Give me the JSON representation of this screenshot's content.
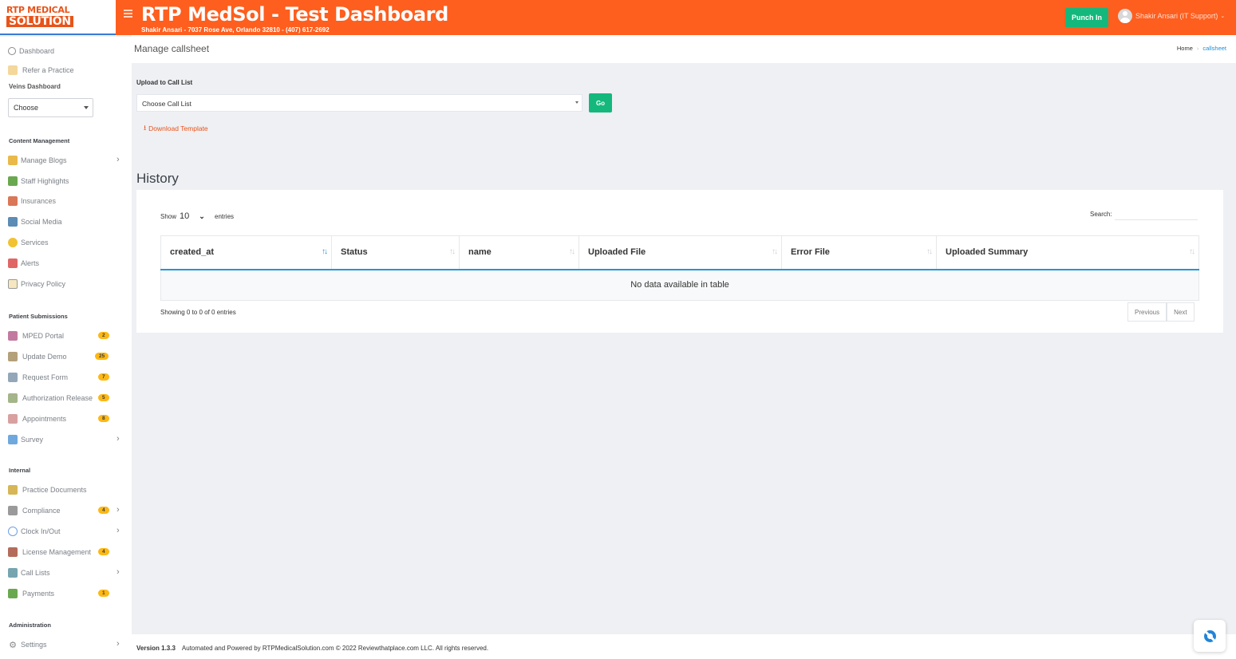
{
  "logo": {
    "line1": "RTP MEDICAL",
    "line2": "SOLUTION"
  },
  "header": {
    "title": "RTP MedSol - Test Dashboard",
    "subtitle": "Shakir Ansari - 7037 Rose Ave, Orlando 32810 - (407) 617-2692",
    "punch_label": "Punch In",
    "user_name": "Shakir Ansari (IT Support)",
    "accent": "#fe5e1e"
  },
  "sidebar": {
    "dashboard": "Dashboard",
    "refer": "Refer a Practice",
    "veins_title": "Veins Dashboard",
    "veins_select": "Choose",
    "sec_content": "Content Management",
    "content_items": [
      {
        "label": "Manage Blogs",
        "icon": "blog-icon"
      },
      {
        "label": "Staff Highlights",
        "icon": "staff-icon"
      },
      {
        "label": "Insurances",
        "icon": "insurance-icon"
      },
      {
        "label": "Social Media",
        "icon": "social-icon"
      },
      {
        "label": "Services",
        "icon": "services-icon"
      },
      {
        "label": "Alerts",
        "icon": "alerts-icon"
      },
      {
        "label": "Privacy Policy",
        "icon": "privacy-icon"
      }
    ],
    "sec_patient": "Patient Submissions",
    "patient_items": [
      {
        "label": "MPED Portal",
        "badge": "2"
      },
      {
        "label": "Update Demo",
        "badge": "25"
      },
      {
        "label": "Request Form",
        "badge": "7"
      },
      {
        "label": "Authorization Release",
        "badge": "5"
      },
      {
        "label": "Appointments",
        "badge": "8"
      },
      {
        "label": "Survey",
        "badge": ""
      }
    ],
    "sec_internal": "Internal",
    "internal_items": [
      {
        "label": "Practice Documents",
        "badge": ""
      },
      {
        "label": "Compliance",
        "badge": "4"
      },
      {
        "label": "Clock In/Out",
        "badge": ""
      },
      {
        "label": "License Management",
        "badge": "4"
      },
      {
        "label": "Call Lists",
        "badge": ""
      },
      {
        "label": "Payments",
        "badge": "1"
      }
    ],
    "sec_admin": "Administration",
    "settings": "Settings"
  },
  "page": {
    "title": "Manage callsheet",
    "breadcrumb_home": "Home",
    "breadcrumb_current": "callsheet"
  },
  "upload": {
    "label": "Upload to Call List",
    "select_value": "Choose Call List",
    "go_label": "Go",
    "download_label": "Download Template"
  },
  "history": {
    "title": "History",
    "show_label": "Show",
    "show_value": "10",
    "entries_label": "entries",
    "search_label": "Search:",
    "columns": [
      "created_at",
      "Status",
      "name",
      "Uploaded File",
      "Error File",
      "Uploaded Summary"
    ],
    "empty_text": "No data available in table",
    "info": "Showing 0 to 0 of 0 entries",
    "prev_label": "Previous",
    "next_label": "Next"
  },
  "footer": {
    "version": "Version 1.3.3",
    "text": "Automated and Powered by RTPMedicalSolution.com © 2022 Reviewthatplace.com LLC. All rights reserved."
  }
}
